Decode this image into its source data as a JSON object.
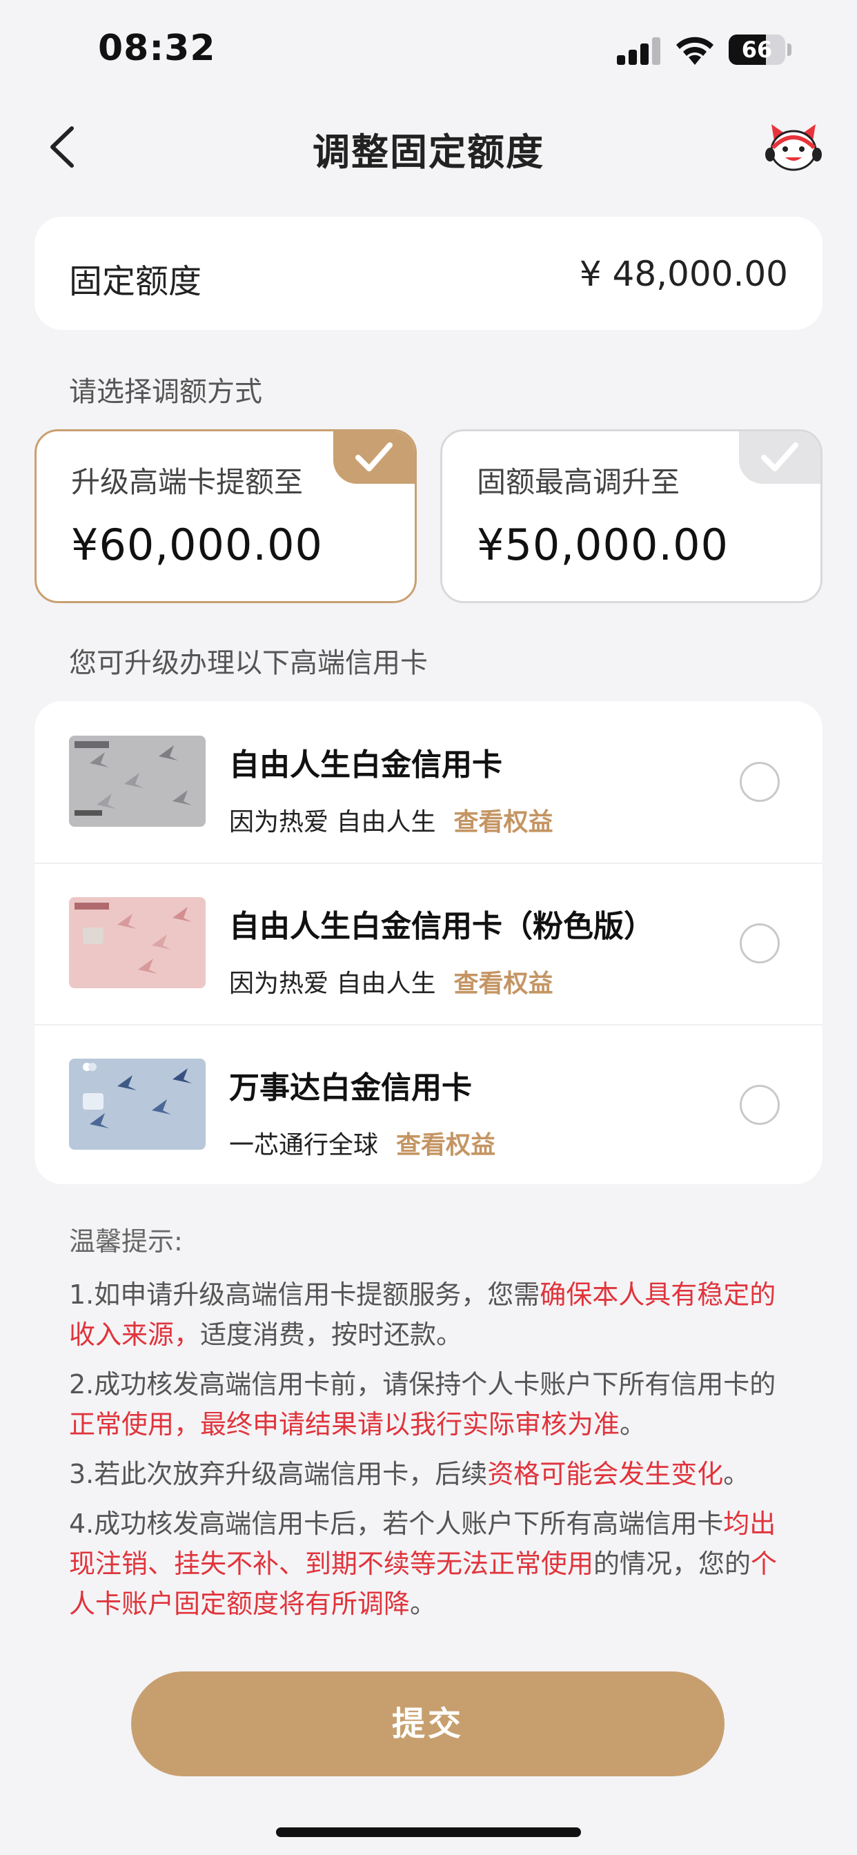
{
  "status_bar": {
    "time": "08:32",
    "battery": "66",
    "battery_level": 0.66
  },
  "nav": {
    "title": "调整固定额度",
    "back_icon": "chevron-left-icon",
    "mascot_icon": "mascot-cat-icon"
  },
  "fixed_limit": {
    "label": "固定额度",
    "value": "¥ 48,000.00"
  },
  "method_section": {
    "label": "请选择调额方式"
  },
  "options": [
    {
      "caption": "升级高端卡提额至",
      "amount": "¥60,000.00",
      "selected": true
    },
    {
      "caption": "固额最高调升至",
      "amount": "¥50,000.00",
      "selected": false
    }
  ],
  "upgrade_section": {
    "label": "您可升级办理以下高端信用卡"
  },
  "cards": [
    {
      "name": "自由人生白金信用卡",
      "slogan": "因为热爱 自由人生",
      "link": "查看权益"
    },
    {
      "name": "自由人生白金信用卡（粉色版）",
      "slogan": "因为热爱 自由人生",
      "link": "查看权益"
    },
    {
      "name": "万事达白金信用卡",
      "slogan": "一芯通行全球",
      "link": "查看权益"
    }
  ],
  "tips": {
    "title": "温馨提示:",
    "items": [
      {
        "a": "1.如申请升级高端信用卡提额服务，您需",
        "b": "确保本人具有稳定的收入来源，",
        "c": "适度消费，按时还款。",
        "d": "",
        "e": ""
      },
      {
        "a": "2.成功核发高端信用卡前，请保持个人卡账户下所有信用卡的",
        "b": "正常使用，最终申请结果请以我行实际审核为准",
        "c": "。",
        "d": "",
        "e": ""
      },
      {
        "a": "3.若此次放弃升级高端信用卡，后续",
        "b": "资格可能会发生变化",
        "c": "。",
        "d": "",
        "e": ""
      },
      {
        "a": "4.成功核发高端信用卡后，若个人账户下所有高端信用卡",
        "b": "均出现注销、挂失不补、到期不续等无法正常使用",
        "c": "的情况，您的",
        "d": "个人卡账户固定额度将有所调降",
        "e": "。"
      }
    ]
  },
  "submit": {
    "label": "提交"
  },
  "colors": {
    "accent": "#c79f6f",
    "warning": "#e0343c",
    "link": "#c49563"
  }
}
